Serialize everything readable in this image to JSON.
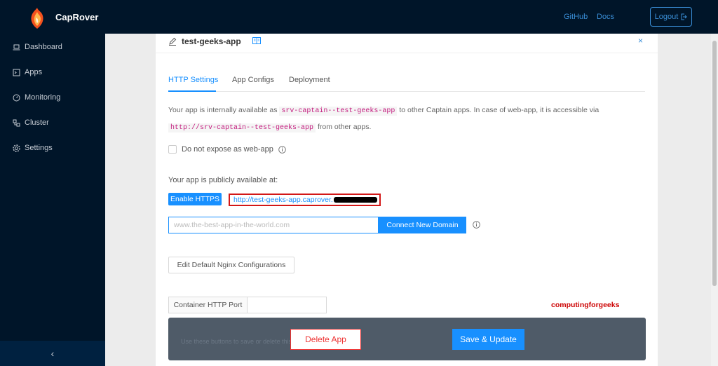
{
  "header": {
    "brand": "CapRover",
    "links": [
      "GitHub",
      "Docs"
    ],
    "logout_label": "Logout",
    "logo_icon": "caprover-logo-icon"
  },
  "sidebar": {
    "items": [
      {
        "label": "Dashboard",
        "icon": "laptop-icon"
      },
      {
        "label": "Apps",
        "icon": "code-icon"
      },
      {
        "label": "Monitoring",
        "icon": "dashboard-gauge-icon"
      },
      {
        "label": "Cluster",
        "icon": "cluster-icon"
      },
      {
        "label": "Settings",
        "icon": "gear-icon"
      }
    ],
    "collapse_glyph": "‹"
  },
  "app": {
    "title": "test-geeks-app",
    "tabs": [
      "HTTP Settings",
      "App Configs",
      "Deployment"
    ],
    "active_tab": "HTTP Settings",
    "description": {
      "part1": "Your app is internally available as ",
      "code1": "srv-captain--test-geeks-app",
      "part2": " to other Captain apps. In case of web-app, it is accessible via ",
      "code2": "http://srv-captain--test-geeks-app",
      "part3": " from other apps."
    },
    "not_expose_label": "Do not expose as web-app",
    "public_label": "Your app is publicly available at:",
    "enable_https_label": "Enable HTTPS",
    "public_url": "http://test-geeks-app.caprover.",
    "domain_placeholder": "www.the-best-app-in-the-world.com",
    "connect_domain_label": "Connect New Domain",
    "nginx_button_label": "Edit Default Nginx Configurations",
    "container_port_label": "Container HTTP Port",
    "container_port_value": "",
    "watermark": "computingforgeeks",
    "footer_hint": "Use these buttons to save or delete this app",
    "delete_label": "Delete App",
    "save_label": "Save & Update"
  },
  "colors": {
    "nav_bg": "#001529",
    "primary": "#1890ff",
    "danger": "#ee3333",
    "footer_bg": "#4f5b68"
  }
}
